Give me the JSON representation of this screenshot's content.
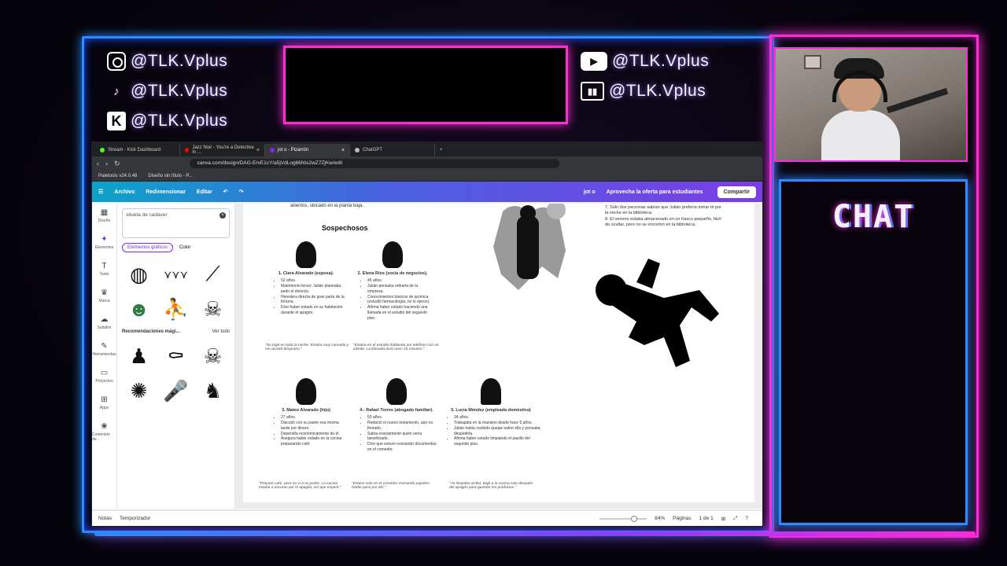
{
  "socials_left": [
    {
      "icon": "instagram-icon",
      "handle": "@TLK.Vplus"
    },
    {
      "icon": "tiktok-icon",
      "handle": "@TLK.Vplus"
    },
    {
      "icon": "kick-icon",
      "handle": "@TLK.Vplus"
    }
  ],
  "socials_right": [
    {
      "icon": "youtube-icon",
      "handle": "@TLK.Vplus"
    },
    {
      "icon": "twitch-icon",
      "handle": "@TLK.Vplus"
    }
  ],
  "chat": {
    "title": "CHAT"
  },
  "browser": {
    "tabs": [
      {
        "label": "Stream - Kick Dashboard",
        "color": "#53fc18"
      },
      {
        "label": "Jazz Noir - You're a Detective in ...",
        "color": "#ff0000"
      },
      {
        "label": "jot o - Pizarrón",
        "color": "#7d2ae8"
      },
      {
        "label": "ChatGPT",
        "color": "#bbbbbb"
      }
    ],
    "url": "canva.com/design/DAG-ErvE1cY/a5jVdLog66NIs2wZ7ZjKw/edit",
    "bookmarks": [
      "Paletools v24.0.48",
      "Diseño sin título - P..."
    ]
  },
  "canva": {
    "file": "Archivo",
    "resize": "Redimensionar",
    "edit": "Editar",
    "doc_title": "jot o",
    "offer": "Aprovecha la oferta para estudiantes",
    "share": "Compartir"
  },
  "rail": [
    "Diseño",
    "Elementos",
    "Texto",
    "Marca",
    "Subidos",
    "Herramientas",
    "Proyectos",
    "Apps",
    "Contenido de..."
  ],
  "panel": {
    "search_value": "silueta de cadaver",
    "chip": "Elementos gráficos",
    "color_filter": "Color",
    "reco_title": "Recomendaciones mági...",
    "reco_link": "Ver todo"
  },
  "page": {
    "top_text": "abiertos, ubicado en la planta baja.",
    "section_title": "Sospechosos",
    "suspects": [
      {
        "name": "1. Clara Alvarado (esposa).",
        "facts": [
          "52 años.",
          "Matrimonio tenso; Julián planeaba pedir el divorcio.",
          "Heredera directa de gran parte de la fortuna.",
          "Dice haber estado en su habitación durante el apagón."
        ],
        "quote": "\"No bajé en toda la noche. Estaba muy cansada y me acosté temprano.\""
      },
      {
        "name": "2. Elena Ríos (socia de negocios).",
        "facts": [
          "45 años.",
          "Julián pensaba retirarla de la empresa.",
          "Conocimientos básicos de química (estudió farmacología, no lo ejerce).",
          "Afirma haber estado haciendo una llamada en el estudio del segundo piso."
        ],
        "quote": "\"Estaba en el estudio hablando por teléfono con un cliente. La llamada duró unos 15 minutos.\""
      },
      {
        "name": "3. Mateo Alvarado (hijo)",
        "facts": [
          "27 años.",
          "Discutió con su padre esa misma tarde por dinero.",
          "Dependía económicamente de él.",
          "Asegura haber estado en la cocina preparando café."
        ],
        "quote": "\"Preparé café, pero no vi a mi padre. La cocina estaba a oscuras por el apagón, así que esperé.\""
      },
      {
        "name": "4.- Rafael Torres (abogado familiar).",
        "facts": [
          "50 años.",
          "Redactó el nuevo testamento, aún no firmado.",
          "Sabía exactamente quién sería beneficiado.",
          "Dice que estuvo revisando documentos en el comedor."
        ],
        "quote": "\"Estuve solo en el comedor revisando papeles. Nadie pasó por ahí.\""
      },
      {
        "name": "5. Lucía Méndez (empleada doméstica)",
        "facts": [
          "34 años.",
          "Trabajaba en la mansión desde hace 5 años.",
          "Julián había recibido quejas sobre ella y pensaba despedirla.",
          "Afirma haber estado limpiando el pasillo del segundo piso."
        ],
        "quote": "\"Yo limpiaba arriba. Bajé a la cocina solo después del apagón para guardar los productos.\""
      }
    ],
    "clues": [
      "7. Solo dos personas sabían que Julián prefería tomar té por la noche en la biblioteca.",
      "8. El veneno estaba almacenado en un frasco pequeño, fácil de ocultar, pero no se encontró en la biblioteca."
    ]
  },
  "status": {
    "notes": "Notas",
    "timer": "Temporizador",
    "zoom": "84%",
    "pages": "Páginas",
    "page_count": "1 de 1"
  }
}
